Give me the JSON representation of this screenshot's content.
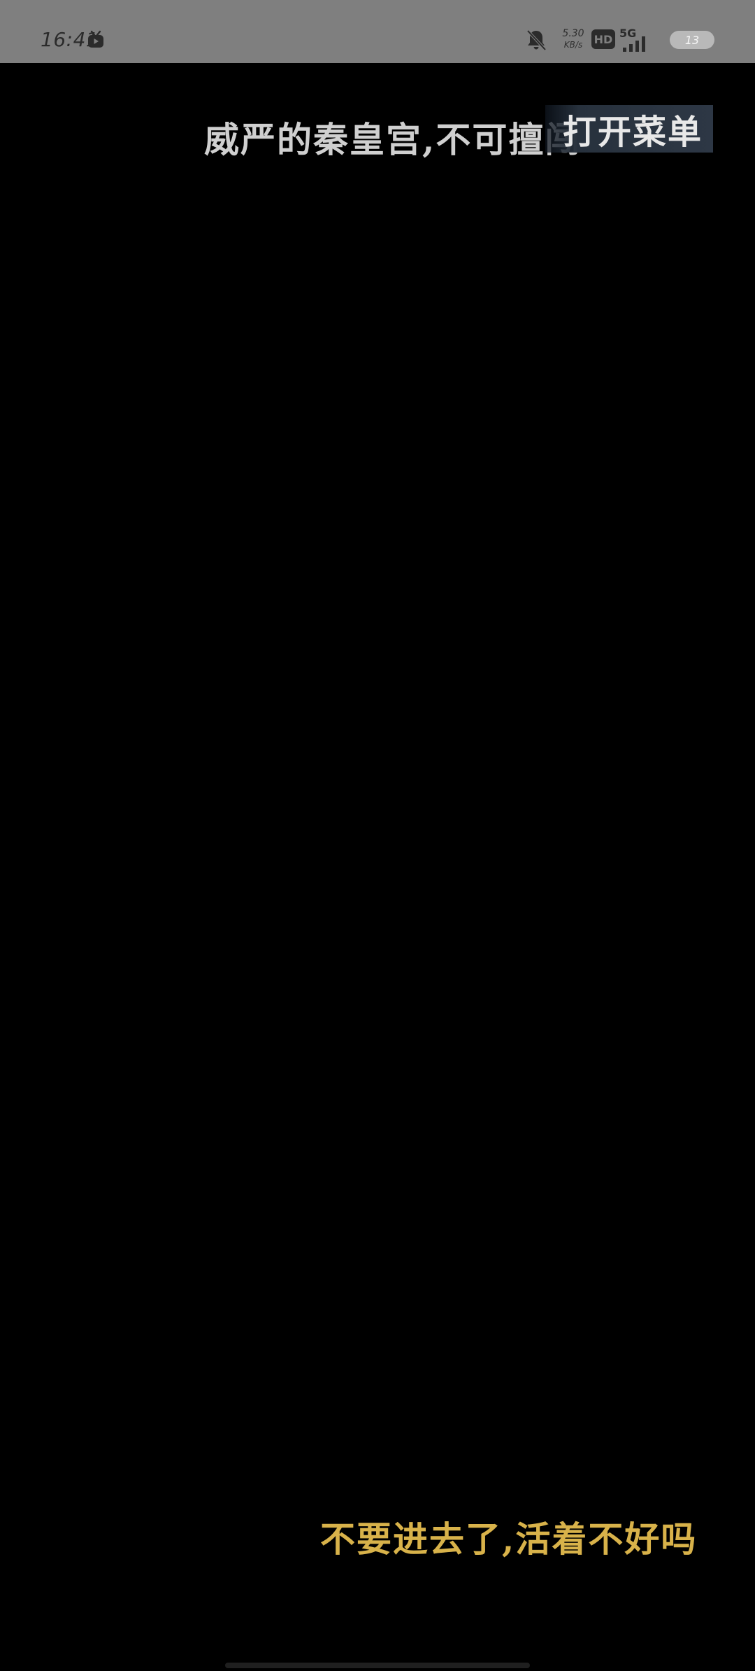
{
  "status_bar": {
    "time": "16:41",
    "net_speed_value": "5.30",
    "net_speed_unit": "KB/s",
    "hd_label": "HD",
    "network_label": "5G",
    "battery_level": "13",
    "icons": [
      "app-tv-icon",
      "mute-bell-icon",
      "signal-strength-icon",
      "battery-icon"
    ]
  },
  "game": {
    "top_caption": "威严的秦皇宫,不可擅闯",
    "menu_button_label": "打开菜单",
    "bottom_caption": "不要进去了,活着不好吗",
    "colors": {
      "background": "#000000",
      "top_caption": "#cfcfcf",
      "bottom_caption": "#d8b24a",
      "menu_button_bg": "#2b3542"
    }
  }
}
